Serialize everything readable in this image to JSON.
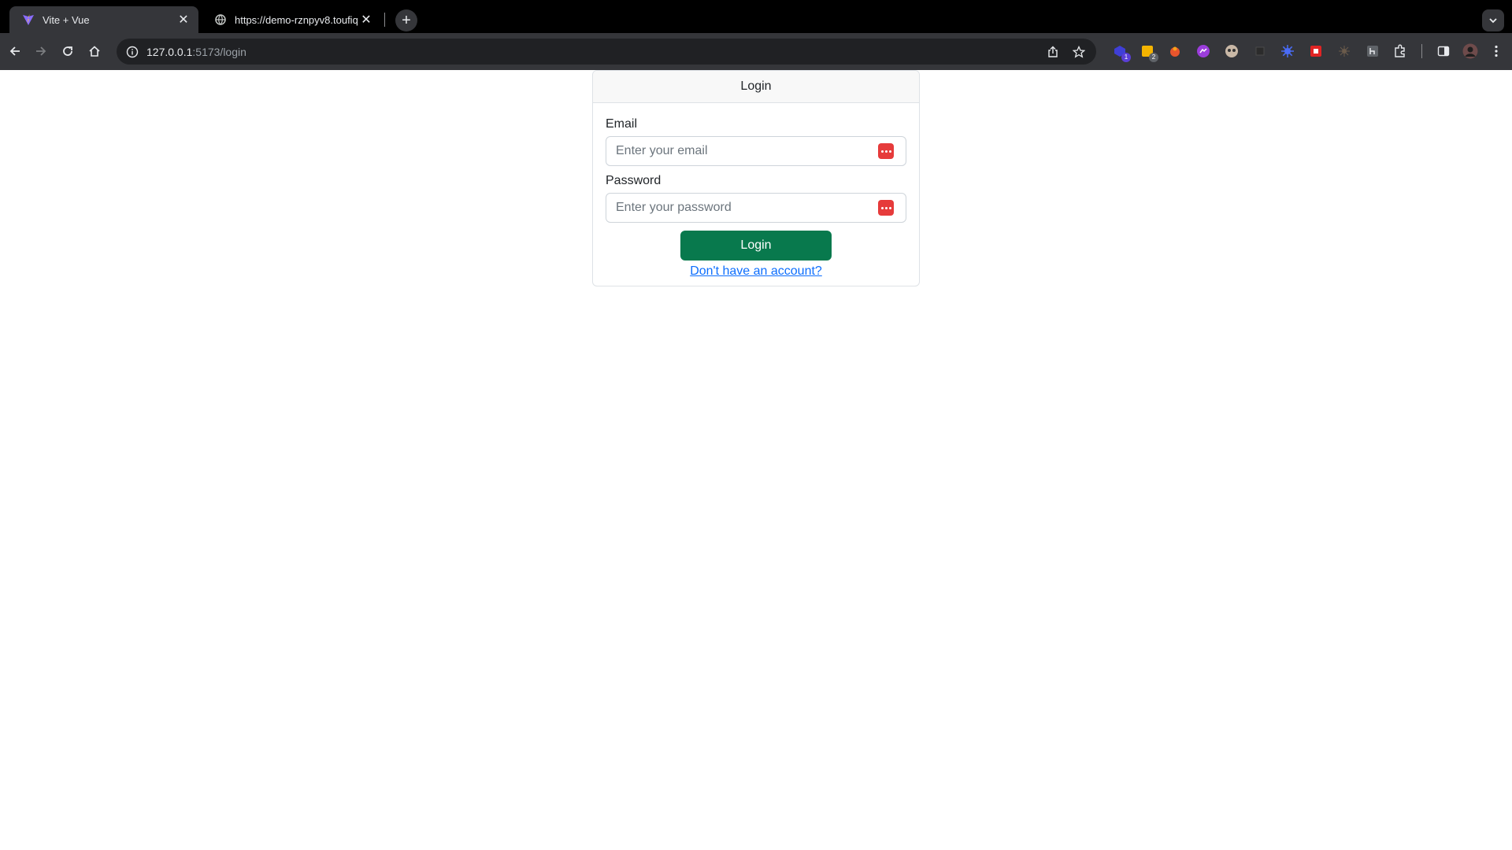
{
  "browser": {
    "tabs": [
      {
        "title": "Vite + Vue",
        "favicon": "vite-icon",
        "active": true
      },
      {
        "title": "https://demo-rznpyv8.toufiq.l",
        "favicon": "globe-icon",
        "active": false
      }
    ],
    "address": {
      "host": "127.0.0.1",
      "path": ":5173/login"
    },
    "extension_badges": [
      "1",
      "2"
    ]
  },
  "login": {
    "header": "Login",
    "email_label": "Email",
    "email_placeholder": "Enter your email",
    "password_label": "Password",
    "password_placeholder": "Enter your password",
    "submit_label": "Login",
    "signup_link": "Don't have an account?"
  },
  "colors": {
    "primary_button": "#08794d",
    "link": "#0d6efd",
    "password_manager_icon": "#e63b3b"
  }
}
